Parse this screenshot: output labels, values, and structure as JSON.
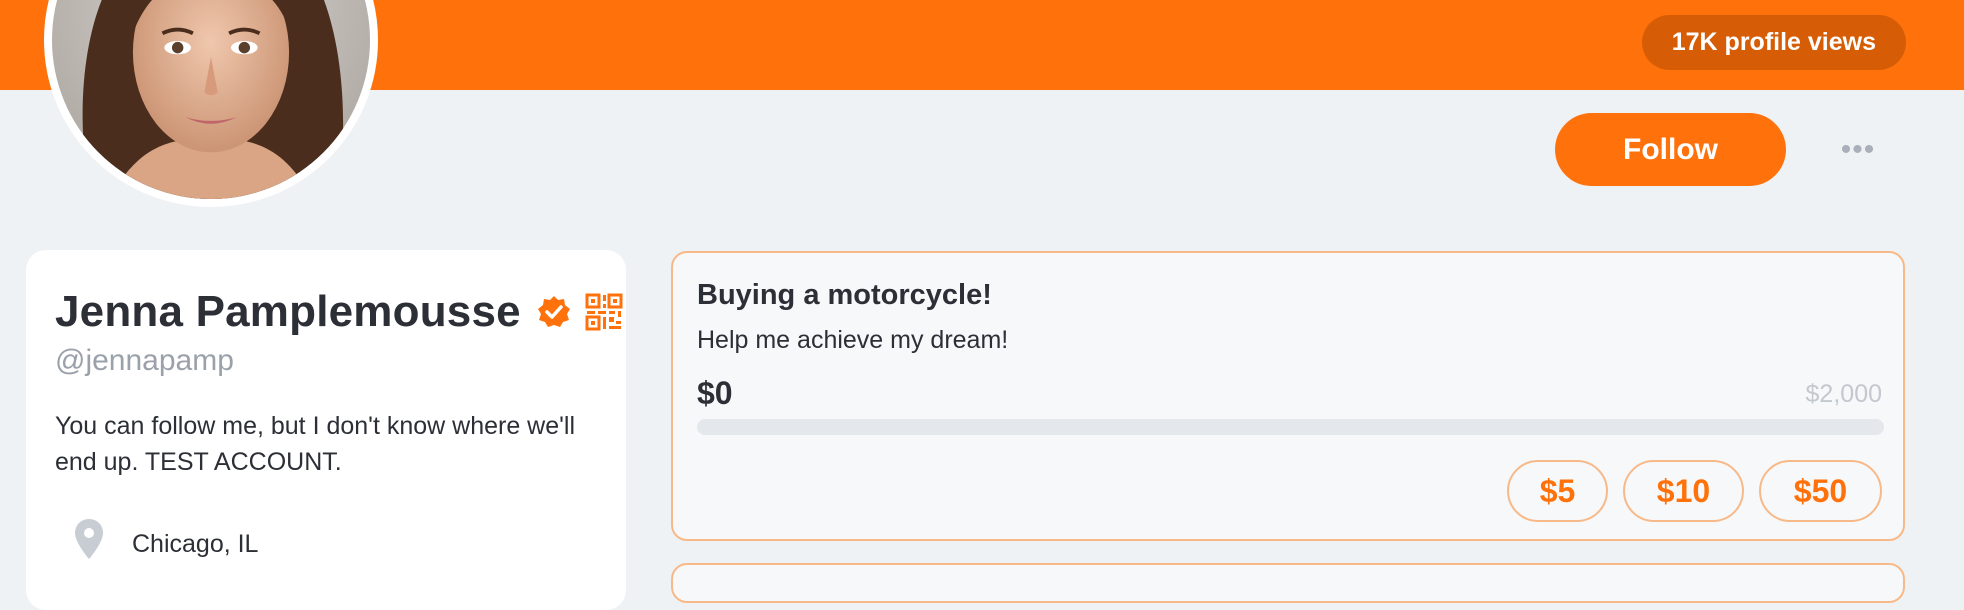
{
  "header": {
    "profile_views": "17K profile views",
    "banner_color": "#ff720b"
  },
  "actions": {
    "follow_label": "Follow",
    "more_label": "•••"
  },
  "profile": {
    "avatar_icon": "user-avatar-photo",
    "name": "Jenna Pamplemousse",
    "handle": "@jennapamp",
    "bio": "You can follow me, but I don't know where we'll end up. TEST ACCOUNT.",
    "location": "Chicago, IL",
    "verified_icon": "verified-badge-icon",
    "qr_icon": "qr-code-icon",
    "location_icon": "map-pin-icon"
  },
  "goal": {
    "title": "Buying a motorcycle!",
    "subtitle": "Help me achieve my dream!",
    "raised": "$0",
    "target": "$2,000",
    "progress_fraction": 0,
    "amounts": [
      "$5",
      "$10",
      "$50"
    ]
  },
  "colors": {
    "accent": "#ff720b",
    "accent_dark": "#d65c05",
    "background": "#eff2f5"
  }
}
